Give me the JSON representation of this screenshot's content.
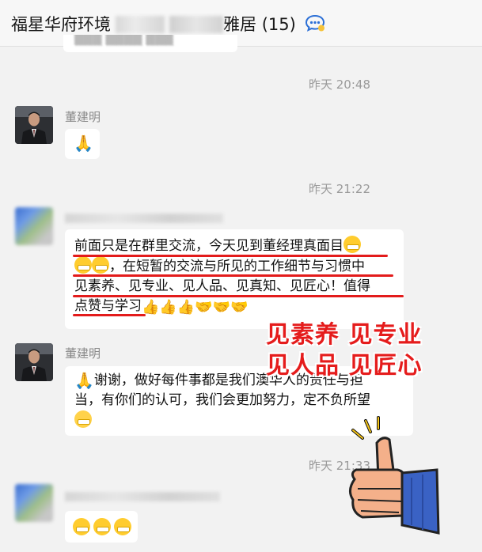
{
  "header": {
    "title_start": "福星华府环境",
    "title_end": "雅居",
    "member_count": "(15)"
  },
  "messages": [
    {
      "type": "time",
      "text": "昨天 20:48"
    },
    {
      "type": "message",
      "sender": "董建明",
      "content": "🙏"
    },
    {
      "type": "time",
      "text": "昨天 21:22"
    },
    {
      "type": "message",
      "lines": [
        "前面只是在群里交流，今天见到董经理真面目",
        "，在短暂的交流与所见的工作细节与习惯中",
        "见素养、见专业、见人品、见真知、见匠心！值得",
        "点赞与学习"
      ]
    },
    {
      "type": "message",
      "sender": "董建明",
      "lines": [
        "谢谢，做好每件事都是我们澳华人的责任与担",
        "当，有你们的认可，我们会更加努力，定不负所望"
      ]
    },
    {
      "type": "time",
      "text": "昨天 21:33"
    }
  ],
  "overlay": {
    "line1": "见素养 见专业",
    "line2": "见人品 见匠心"
  },
  "colors": {
    "accent_red": "#e51c1c",
    "background": "#f2f2f2",
    "bubble": "#ffffff"
  },
  "icons": [
    "group-chat-icon",
    "folded-hands-emoji",
    "grinning-emoji",
    "thumbs-up-emoji",
    "handshake-emoji",
    "smile-emoji",
    "blessed-emoji",
    "thumbs-up-sticker"
  ]
}
